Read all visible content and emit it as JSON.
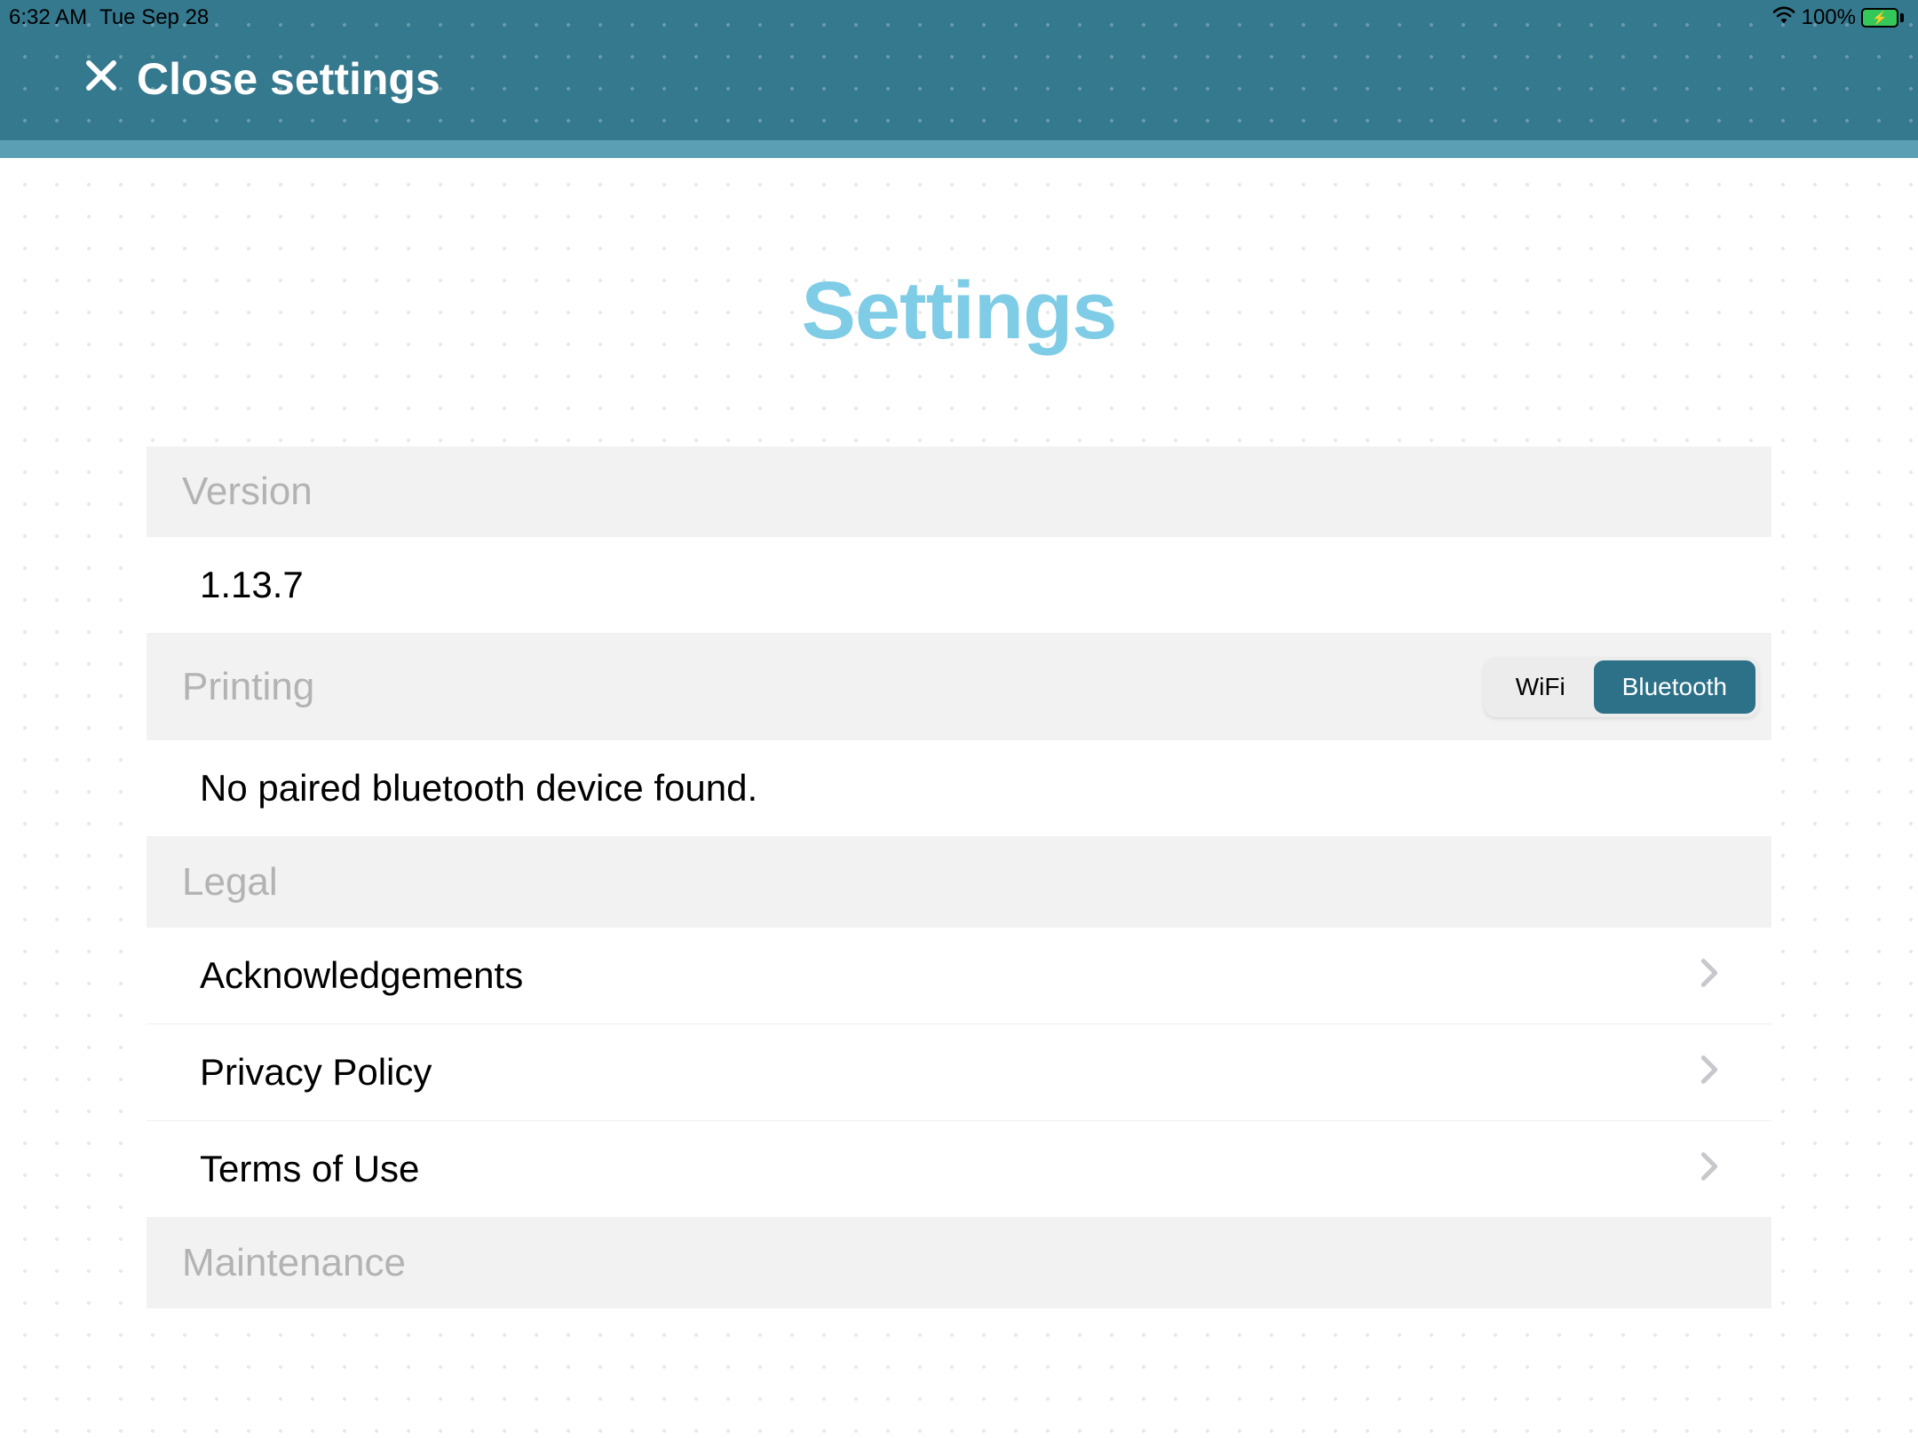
{
  "status_bar": {
    "time": "6:32 AM",
    "date": "Tue Sep 28",
    "battery_percent": "100%"
  },
  "header": {
    "close_label": "Close settings"
  },
  "page": {
    "title": "Settings"
  },
  "sections": {
    "version": {
      "header": "Version",
      "value": "1.13.7"
    },
    "printing": {
      "header": "Printing",
      "segments": {
        "wifi": "WiFi",
        "bluetooth": "Bluetooth"
      },
      "selected": "bluetooth",
      "status_text": "No paired bluetooth device found."
    },
    "legal": {
      "header": "Legal",
      "items": {
        "acknowledgements": "Acknowledgements",
        "privacy": "Privacy Policy",
        "terms": "Terms of Use"
      }
    },
    "maintenance": {
      "header": "Maintenance"
    }
  }
}
